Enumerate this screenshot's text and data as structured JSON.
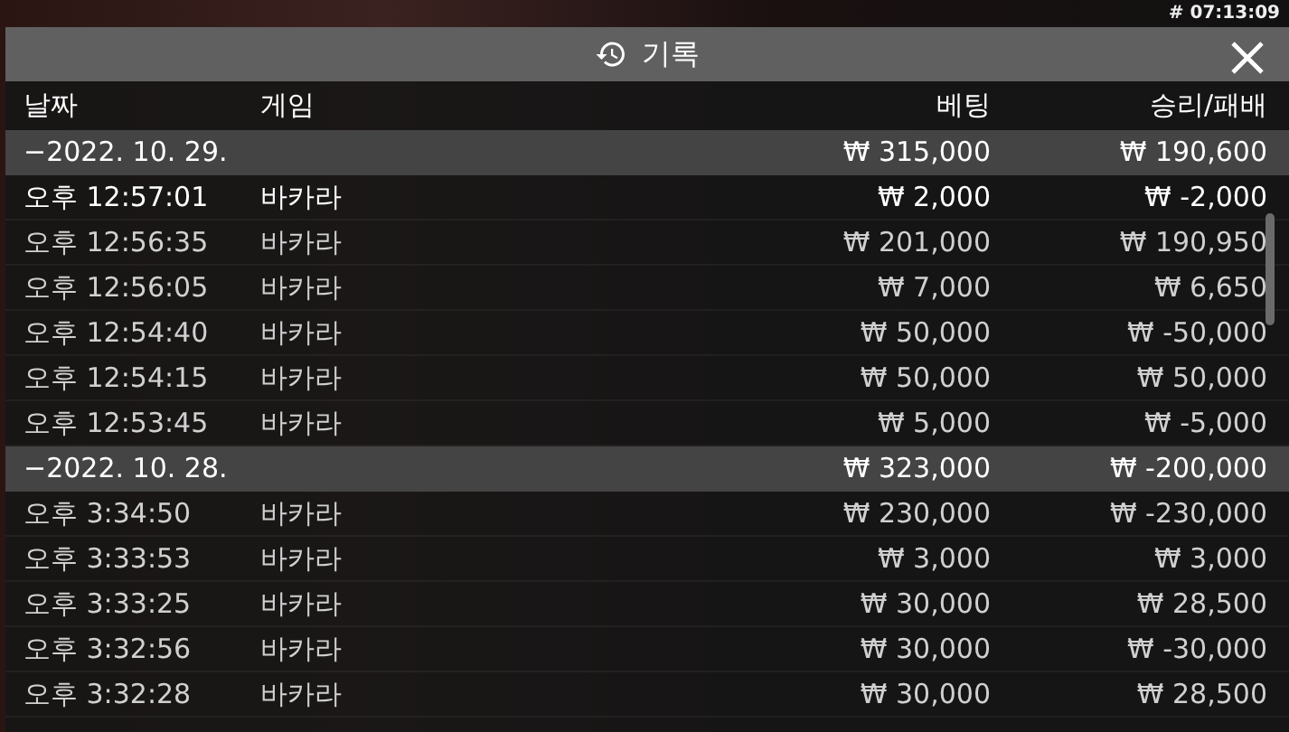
{
  "clock": "# 07:13:09",
  "title": "기록",
  "columns": [
    "날짜",
    "게임",
    "베팅",
    "승리/패배"
  ],
  "groups": [
    {
      "date": "−2022. 10. 29.",
      "bet": "₩ 315,000",
      "result": "₩ 190,600",
      "rows": [
        {
          "time": "오후 12:57:01",
          "game": "바카라",
          "bet": "₩ 2,000",
          "result": "₩ -2,000",
          "selected": true
        },
        {
          "time": "오후 12:56:35",
          "game": "바카라",
          "bet": "₩ 201,000",
          "result": "₩ 190,950",
          "selected": false
        },
        {
          "time": "오후 12:56:05",
          "game": "바카라",
          "bet": "₩ 7,000",
          "result": "₩ 6,650",
          "selected": false
        },
        {
          "time": "오후 12:54:40",
          "game": "바카라",
          "bet": "₩ 50,000",
          "result": "₩ -50,000",
          "selected": false
        },
        {
          "time": "오후 12:54:15",
          "game": "바카라",
          "bet": "₩ 50,000",
          "result": "₩ 50,000",
          "selected": false
        },
        {
          "time": "오후 12:53:45",
          "game": "바카라",
          "bet": "₩ 5,000",
          "result": "₩ -5,000",
          "selected": false
        }
      ]
    },
    {
      "date": "−2022. 10. 28.",
      "bet": "₩ 323,000",
      "result": "₩ -200,000",
      "rows": [
        {
          "time": "오후 3:34:50",
          "game": "바카라",
          "bet": "₩ 230,000",
          "result": "₩ -230,000",
          "selected": false
        },
        {
          "time": "오후 3:33:53",
          "game": "바카라",
          "bet": "₩ 3,000",
          "result": "₩ 3,000",
          "selected": false
        },
        {
          "time": "오후 3:33:25",
          "game": "바카라",
          "bet": "₩ 30,000",
          "result": "₩ 28,500",
          "selected": false
        },
        {
          "time": "오후 3:32:56",
          "game": "바카라",
          "bet": "₩ 30,000",
          "result": "₩ -30,000",
          "selected": false
        },
        {
          "time": "오후 3:32:28",
          "game": "바카라",
          "bet": "₩ 30,000",
          "result": "₩ 28,500",
          "selected": false
        }
      ]
    }
  ]
}
